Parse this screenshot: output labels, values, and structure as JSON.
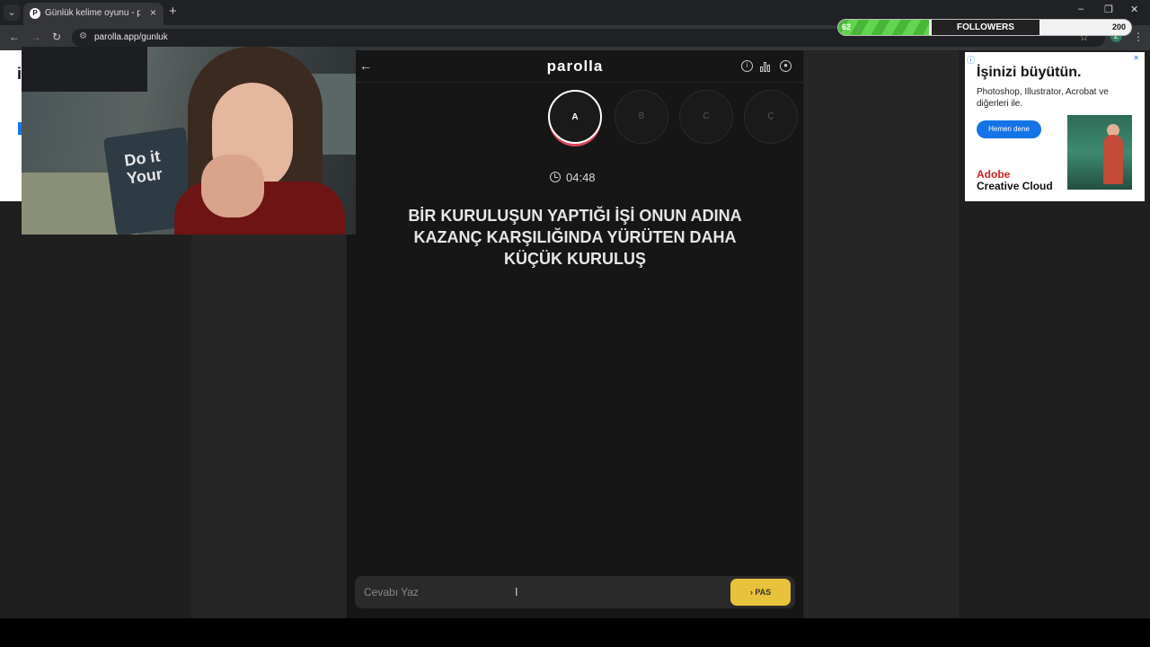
{
  "browser": {
    "tab_title": "Günlük kelime oyunu - parolla",
    "tab_favicon": "P",
    "tab_close": "×",
    "new_tab": "+",
    "url": "parolla.app/gunluk",
    "profile_initial": "Z"
  },
  "stream_overlay": {
    "goal_label": "FOLLOWERS",
    "goal_current": "62",
    "goal_target": "200",
    "goal_progress": 0.31,
    "webcam_shirt_text": "Do it Your"
  },
  "app": {
    "logo": "parolla",
    "letters": [
      {
        "label": "A",
        "state": "active"
      },
      {
        "label": "B",
        "state": "inactive"
      },
      {
        "label": "C",
        "state": "inactive"
      },
      {
        "label": "Ç",
        "state": "inactive"
      }
    ],
    "timer": "04:48",
    "question": "BİR KURULUŞUN YAPTIĞI İŞİ ONUN ADINA KAZANÇ KARŞILIĞINDA YÜRÜTEN DAHA KÜÇÜK KURULUŞ",
    "answer_placeholder": "Cevabı Yaz",
    "pass_label": "PAS",
    "accent_color": "#e8c23a",
    "active_ring_color": "#e0445a"
  },
  "ad_right": {
    "headline": "İşinizi büyütün.",
    "body": "Photoshop, Illustrator, Acrobat ve diğerleri ile.",
    "cta": "Hemen dene",
    "brand_line1": "Adobe",
    "brand_line2": "Creative Cloud"
  },
  "ad_left": {
    "letter": "i"
  }
}
